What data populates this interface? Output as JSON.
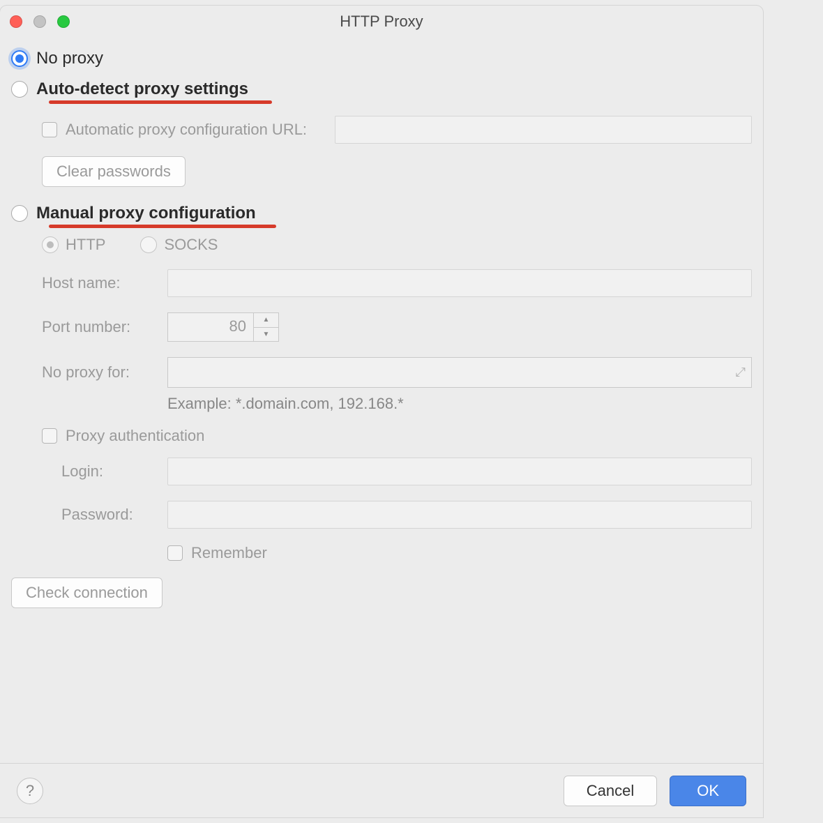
{
  "window": {
    "title": "HTTP Proxy"
  },
  "proxy": {
    "no_proxy": "No proxy",
    "auto_detect": "Auto-detect proxy settings",
    "auto_url_label": "Automatic proxy configuration URL:",
    "clear_passwords": "Clear passwords",
    "manual": "Manual proxy configuration",
    "type_http": "HTTP",
    "type_socks": "SOCKS",
    "host_label": "Host name:",
    "port_label": "Port number:",
    "port_value": "80",
    "no_proxy_for_label": "No proxy for:",
    "example": "Example: *.domain.com, 192.168.*",
    "auth_label": "Proxy authentication",
    "login_label": "Login:",
    "password_label": "Password:",
    "remember_label": "Remember",
    "check_connection": "Check connection"
  },
  "footer": {
    "cancel": "Cancel",
    "ok": "OK",
    "help": "?"
  }
}
